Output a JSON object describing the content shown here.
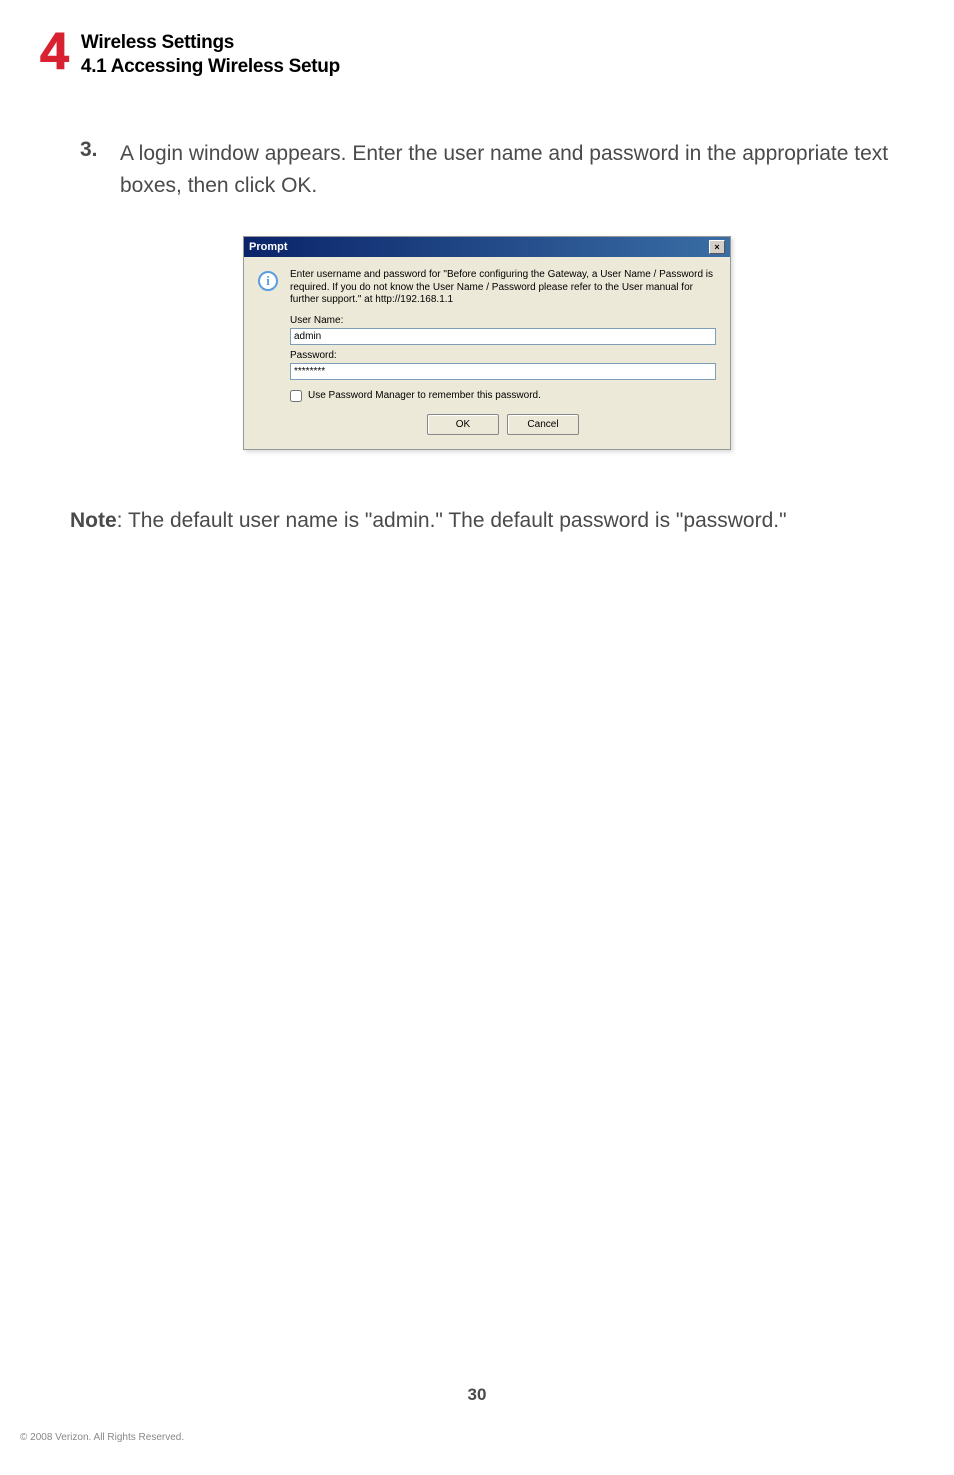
{
  "header": {
    "chapter_number": "4",
    "title": "Wireless Settings",
    "subtitle": "4.1  Accessing Wireless Setup"
  },
  "step": {
    "number": "3.",
    "text": "A login window appears. Enter the user name and password in the appropriate text boxes, then click OK."
  },
  "dialog": {
    "title": "Prompt",
    "close_label": "×",
    "info_symbol": "i",
    "message": "Enter username and password for \"Before configuring the Gateway, a User Name / Password is required. If you do not know the User Name / Password please refer to the User manual for further support.\" at http://192.168.1.1",
    "username_label": "User Name:",
    "username_value": "admin",
    "password_label": "Password:",
    "password_value": "********",
    "checkbox_label": "Use Password Manager to remember this password.",
    "ok_label": "OK",
    "cancel_label": "Cancel"
  },
  "note": {
    "label": "Note",
    "text": ": The default user name is \"admin.\" The default password is \"password.\""
  },
  "footer": {
    "page_number": "30",
    "copyright": "© 2008 Verizon. All Rights Reserved."
  }
}
